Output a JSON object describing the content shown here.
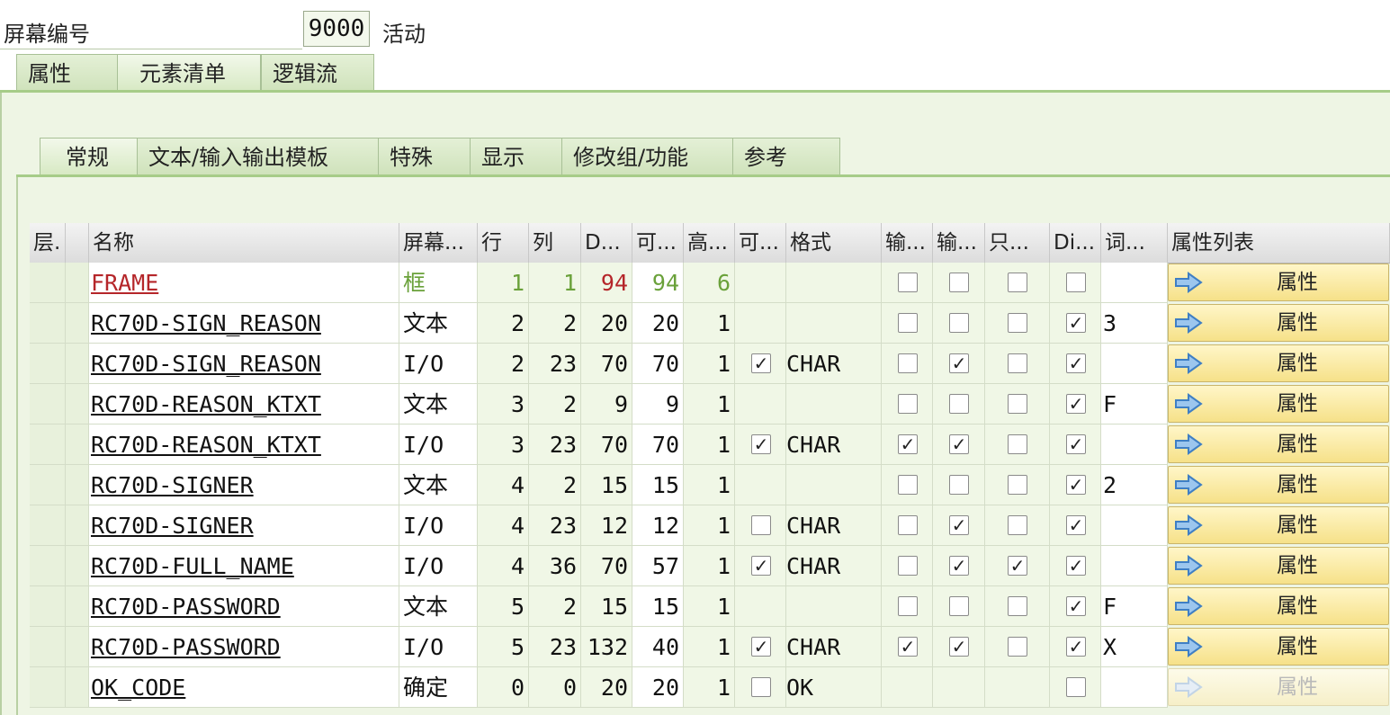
{
  "header": {
    "screen_number_label": "屏幕编号",
    "screen_number_value": "9000",
    "status": "活动"
  },
  "main_tabs": [
    {
      "label": "属性"
    },
    {
      "label": "元素清单"
    },
    {
      "label": "逻辑流"
    }
  ],
  "sub_tabs": [
    {
      "label": "常规"
    },
    {
      "label": "文本/输入输出模板"
    },
    {
      "label": "特殊"
    },
    {
      "label": "显示"
    },
    {
      "label": "修改组/功能"
    },
    {
      "label": "参考"
    }
  ],
  "columns": [
    "层.",
    "",
    "名称",
    "屏幕...",
    "行",
    "列",
    "D...",
    "可...",
    "高...",
    "可...",
    "格式",
    "输...",
    "输...",
    "只...",
    "Di...",
    "词...",
    "属性列表"
  ],
  "attr_button_label": "属性",
  "rows": [
    {
      "name": "FRAME",
      "type": "框",
      "row": "1",
      "col": "1",
      "d": "94",
      "vis": "94",
      "h": "6",
      "scroll": null,
      "fmt": "",
      "inp": false,
      "out": false,
      "ro": false,
      "di": false,
      "dict": "",
      "style": "frame",
      "disabled": false
    },
    {
      "name": "RC70D-SIGN_REASON",
      "type": "文本",
      "row": "2",
      "col": "2",
      "d": "20",
      "vis": "20",
      "h": "1",
      "scroll": null,
      "fmt": "",
      "inp": false,
      "out": false,
      "ro": false,
      "di": true,
      "dict": "3",
      "style": "text",
      "disabled": false
    },
    {
      "name": "RC70D-SIGN_REASON",
      "type": "I/O",
      "row": "2",
      "col": "23",
      "d": "70",
      "vis": "70",
      "h": "1",
      "scroll": true,
      "fmt": "CHAR",
      "inp": false,
      "out": true,
      "ro": false,
      "di": true,
      "dict": "",
      "style": "io",
      "disabled": false
    },
    {
      "name": "RC70D-REASON_KTXT",
      "type": "文本",
      "row": "3",
      "col": "2",
      "d": "9",
      "vis": "9",
      "h": "1",
      "scroll": null,
      "fmt": "",
      "inp": false,
      "out": false,
      "ro": false,
      "di": true,
      "dict": "F",
      "style": "text",
      "disabled": false
    },
    {
      "name": "RC70D-REASON_KTXT",
      "type": "I/O",
      "row": "3",
      "col": "23",
      "d": "70",
      "vis": "70",
      "h": "1",
      "scroll": true,
      "fmt": "CHAR",
      "inp": true,
      "out": true,
      "ro": false,
      "di": true,
      "dict": "",
      "style": "io",
      "disabled": false
    },
    {
      "name": "RC70D-SIGNER",
      "type": "文本",
      "row": "4",
      "col": "2",
      "d": "15",
      "vis": "15",
      "h": "1",
      "scroll": null,
      "fmt": "",
      "inp": false,
      "out": false,
      "ro": false,
      "di": true,
      "dict": "2",
      "style": "text",
      "disabled": false
    },
    {
      "name": "RC70D-SIGNER",
      "type": "I/O",
      "row": "4",
      "col": "23",
      "d": "12",
      "vis": "12",
      "h": "1",
      "scroll": false,
      "fmt": "CHAR",
      "inp": false,
      "out": true,
      "ro": false,
      "di": true,
      "dict": "",
      "style": "io",
      "disabled": false
    },
    {
      "name": "RC70D-FULL_NAME",
      "type": "I/O",
      "row": "4",
      "col": "36",
      "d": "70",
      "vis": "57",
      "h": "1",
      "scroll": true,
      "fmt": "CHAR",
      "inp": false,
      "out": true,
      "ro": true,
      "di": true,
      "dict": "",
      "style": "io",
      "disabled": false
    },
    {
      "name": "RC70D-PASSWORD",
      "type": "文本",
      "row": "5",
      "col": "2",
      "d": "15",
      "vis": "15",
      "h": "1",
      "scroll": null,
      "fmt": "",
      "inp": false,
      "out": false,
      "ro": false,
      "di": true,
      "dict": "F",
      "style": "text",
      "disabled": false
    },
    {
      "name": "RC70D-PASSWORD",
      "type": "I/O",
      "row": "5",
      "col": "23",
      "d": "132",
      "vis": "40",
      "h": "1",
      "scroll": true,
      "fmt": "CHAR",
      "inp": true,
      "out": true,
      "ro": false,
      "di": true,
      "dict": "X",
      "style": "io",
      "disabled": false
    },
    {
      "name": "OK_CODE",
      "type": "确定",
      "row": "0",
      "col": "0",
      "d": "20",
      "vis": "20",
      "h": "1",
      "scroll": false,
      "fmt": " OK",
      "inp": null,
      "out": null,
      "ro": null,
      "di": false,
      "dict": "",
      "style": "ok",
      "disabled": true
    }
  ],
  "colors": {
    "frame_name": "#b5262a",
    "frame_type": "#6aa13a",
    "accent_tab": "#a6cc88",
    "button_yellow": "#f6e189",
    "arrow_blue": "#3f7fc4"
  }
}
